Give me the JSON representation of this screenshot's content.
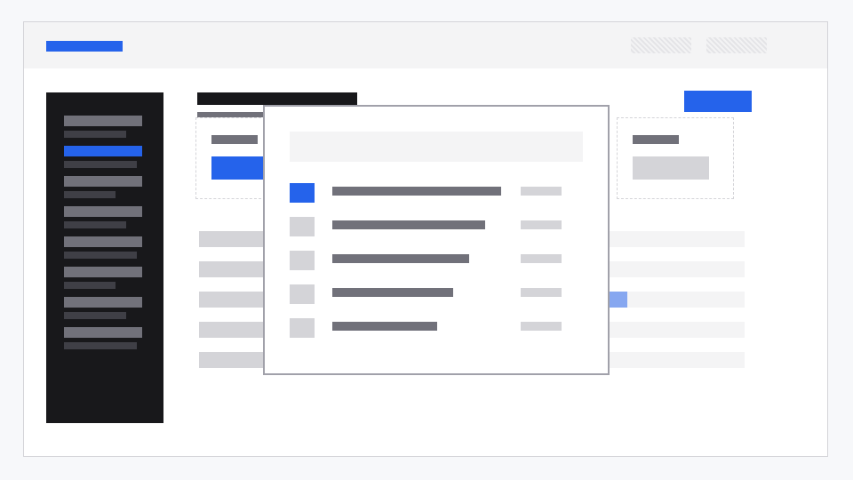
{
  "colors": {
    "accent": "#2563eb",
    "accent_light": "#86a7f0",
    "sidebar_bg": "#18181b",
    "text_placeholder": "#71717a",
    "muted_placeholder": "#d4d4d8",
    "panel_bg": "#f4f4f5"
  },
  "header": {
    "logo": "",
    "actions": [
      "",
      ""
    ]
  },
  "sidebar": {
    "active_index": 1,
    "items": [
      {
        "label": "",
        "sub": ""
      },
      {
        "label": "",
        "sub": ""
      },
      {
        "label": "",
        "sub": ""
      },
      {
        "label": "",
        "sub": ""
      },
      {
        "label": "",
        "sub": ""
      },
      {
        "label": "",
        "sub": ""
      },
      {
        "label": "",
        "sub": ""
      },
      {
        "label": "",
        "sub": ""
      }
    ]
  },
  "main": {
    "title": "",
    "subtitle": "",
    "primary_action": "",
    "card_left": {
      "label": "",
      "button": ""
    },
    "card_right": {
      "label": "",
      "value": ""
    },
    "list_rows": 5,
    "highlighted_row_index": 2
  },
  "modal": {
    "search": {
      "value": "",
      "placeholder": ""
    },
    "rows": [
      {
        "name": "",
        "meta": "",
        "checked": true
      },
      {
        "name": "",
        "meta": "",
        "checked": false
      },
      {
        "name": "",
        "meta": "",
        "checked": false
      },
      {
        "name": "",
        "meta": "",
        "checked": false
      },
      {
        "name": "",
        "meta": "",
        "checked": false
      }
    ]
  }
}
